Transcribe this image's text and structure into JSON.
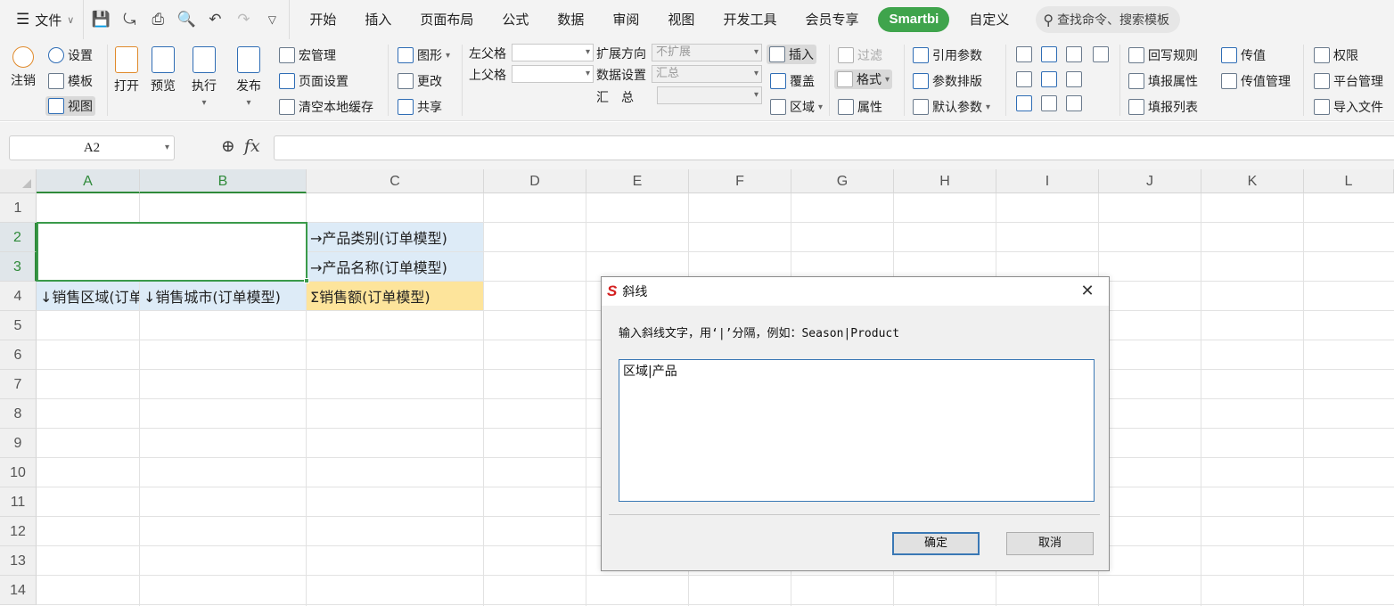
{
  "menubar": {
    "file_label": "文件",
    "tabs": [
      "开始",
      "插入",
      "页面布局",
      "公式",
      "数据",
      "审阅",
      "视图",
      "开发工具",
      "会员专享",
      "Smartbi",
      "自定义"
    ],
    "search_placeholder": "查找命令、搜索模板"
  },
  "ribbon": {
    "logout": "注销",
    "settings": "设置",
    "template": "模板",
    "view": "视图",
    "open": "打开",
    "preview": "预览",
    "execute": "执行",
    "publish": "发布",
    "macro": "宏管理",
    "page_setup": "页面设置",
    "clear_cache": "清空本地缓存",
    "chart": "图形",
    "change": "更改",
    "share": "共享",
    "left_parent": "左父格",
    "upper_parent": "上父格",
    "expand_dir": "扩展方向",
    "expand_value": "不扩展",
    "data_setting": "数据设置",
    "data_setting_value": "汇总",
    "summary": "汇　总",
    "insert": "插入",
    "cover": "覆盖",
    "region": "区域",
    "filter": "过滤",
    "format": "格式",
    "property": "属性",
    "ref_param": "引用参数",
    "param_layout": "参数排版",
    "default_param": "默认参数",
    "writeback_rule": "回写规则",
    "fill_property": "填报属性",
    "fill_list": "填报列表",
    "pass_value": "传值",
    "pass_value_mgmt": "传值管理",
    "permission": "权限",
    "platform_mgmt": "平台管理",
    "import_file": "导入文件"
  },
  "formula_bar": {
    "name_box": "A2",
    "fx": "fx",
    "formula": ""
  },
  "sheet": {
    "columns": [
      "A",
      "B",
      "C",
      "D",
      "E",
      "F",
      "G",
      "H",
      "I",
      "J",
      "K",
      "L"
    ],
    "rows": [
      "1",
      "2",
      "3",
      "4",
      "5",
      "6",
      "7",
      "8",
      "9",
      "10",
      "11",
      "12",
      "13",
      "14"
    ],
    "cells": {
      "C2": "→产品类别(订单模型)",
      "C3": "→产品名称(订单模型)",
      "A4": "↓销售区域(订单模型)",
      "B4": "↓销售城市(订单模型)",
      "C4": "Σ销售额(订单模型)"
    }
  },
  "dialog": {
    "title": "斜线",
    "prompt": "输入斜线文字，用‘|’分隔，例如：Season|Product",
    "text_value": "区域|产品",
    "ok_label": "确定",
    "cancel_label": "取消"
  },
  "colors": {
    "smartbi_tab": "#3fa44c",
    "selection": "#3a9a4a",
    "dim_blue": "#ddebf7",
    "measure_yellow": "#fde49b"
  }
}
